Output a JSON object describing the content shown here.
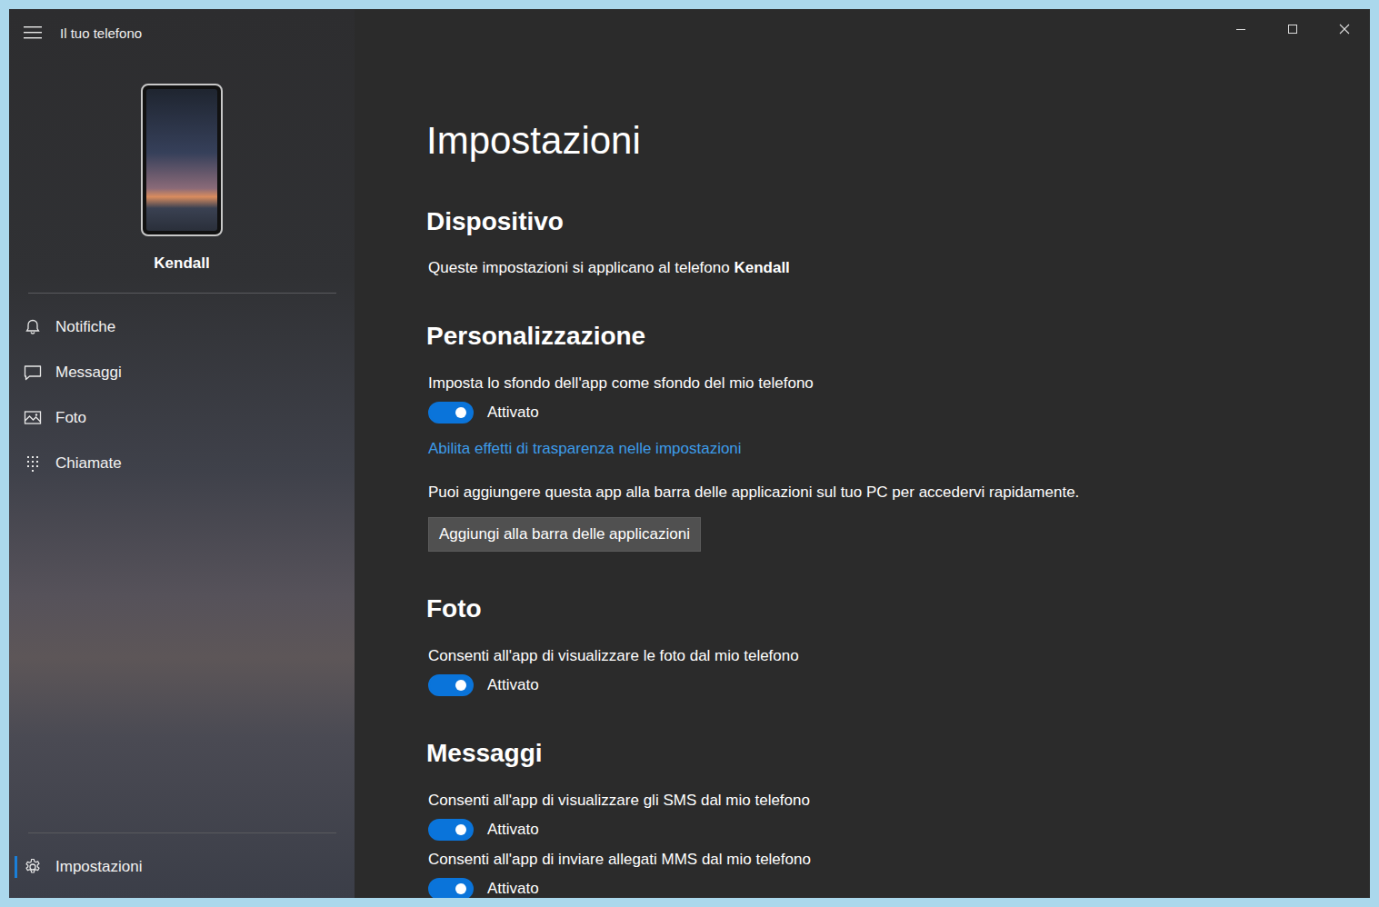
{
  "window": {
    "title": "Il tuo telefono"
  },
  "phone": {
    "name": "Kendall"
  },
  "sidebar": {
    "items": [
      {
        "label": "Notifiche",
        "selected": false
      },
      {
        "label": "Messaggi",
        "selected": false
      },
      {
        "label": "Foto",
        "selected": false
      },
      {
        "label": "Chiamate",
        "selected": false
      }
    ],
    "footer": {
      "label": "Impostazioni",
      "selected": true
    }
  },
  "page": {
    "title": "Impostazioni"
  },
  "sections": [
    {
      "heading": "Dispositivo",
      "items": [
        {
          "kind": "text",
          "text": "Queste impostazioni si applicano al telefono ",
          "strong": "Kendall"
        }
      ]
    },
    {
      "heading": "Personalizzazione",
      "items": [
        {
          "kind": "toggle",
          "label": "Imposta lo sfondo dell'app come sfondo del mio telefono",
          "on": true,
          "state": "Attivato"
        },
        {
          "kind": "link",
          "text": "Abilita effetti di trasparenza nelle impostazioni"
        },
        {
          "kind": "paragraph",
          "text": "Puoi aggiungere questa app alla barra delle applicazioni sul tuo PC per accedervi rapidamente."
        },
        {
          "kind": "button",
          "text": "Aggiungi alla barra delle applicazioni"
        }
      ]
    },
    {
      "heading": "Foto",
      "items": [
        {
          "kind": "toggle",
          "label": "Consenti all'app di visualizzare le foto dal mio telefono",
          "on": true,
          "state": "Attivato"
        }
      ]
    },
    {
      "heading": "Messaggi",
      "items": [
        {
          "kind": "toggle",
          "label": "Consenti all'app di visualizzare gli SMS dal mio telefono",
          "on": true,
          "state": "Attivato"
        },
        {
          "kind": "toggle",
          "label": "Consenti all'app di inviare allegati MMS dal mio telefono",
          "on": true,
          "state": "Attivato"
        }
      ]
    }
  ]
}
